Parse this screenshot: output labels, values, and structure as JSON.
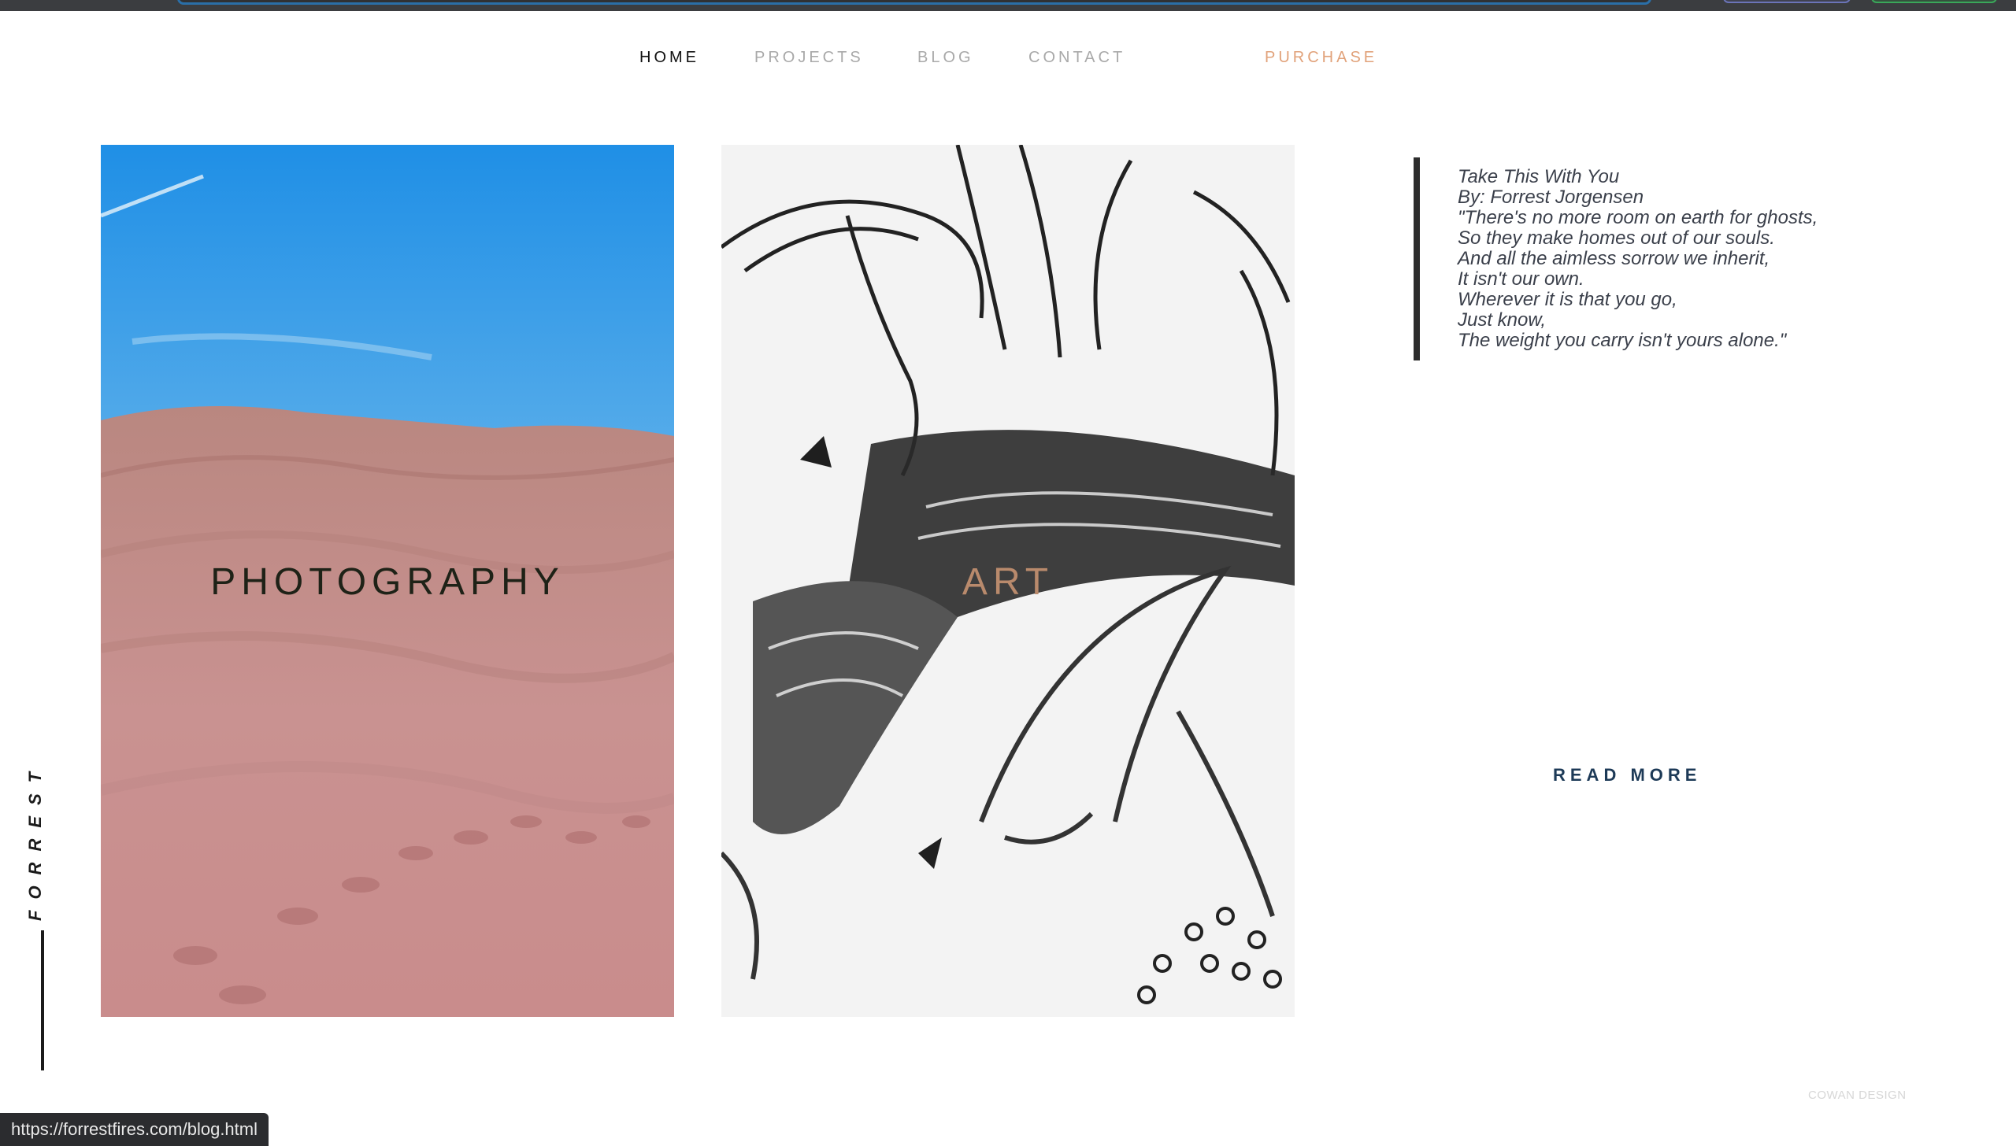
{
  "nav": {
    "home": "HOME",
    "projects": "PROJECTS",
    "blog": "BLOG",
    "contact": "CONTACT",
    "purchase": "PURCHASE"
  },
  "cards": {
    "photography": "PHOTOGRAPHY",
    "art": "ART"
  },
  "poem": {
    "lines": [
      "Take This With You",
      "By: Forrest Jorgensen",
      "\"There's no more room on earth for ghosts,",
      "So they make homes out of our souls.",
      "And all the aimless sorrow we inherit,",
      "It isn't our own.",
      "Wherever it is that you go,",
      "Just know,",
      "The weight you carry isn't yours alone.\""
    ]
  },
  "read_more": "READ MORE",
  "brand": "FORREST",
  "footer_credit": "COWAN DESIGN",
  "status_bar_url": "https://forrestfires.com/blog.html",
  "colors": {
    "nav_active": "#111111",
    "nav_inactive": "#a9a9a9",
    "purchase_accent": "#e1a27a",
    "read_more": "#1d3a57"
  }
}
